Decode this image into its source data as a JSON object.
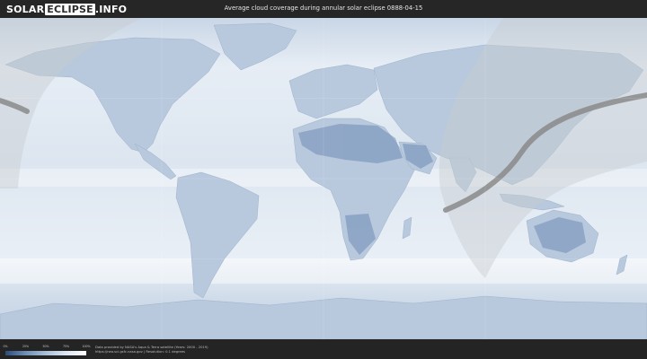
{
  "header": {
    "logo_part1": "SOLAR",
    "logo_part2": "ECLIPSE",
    "logo_part3": ".INFO",
    "title": "Average cloud coverage during annular solar eclipse 0888-04-15"
  },
  "legend": {
    "ticks": [
      "0%",
      "25%",
      "50%",
      "75%",
      "100%"
    ]
  },
  "footer": {
    "credit_line1": "Data provided by NASA's Aqua & Terra satellite (Years: 2000 - 2019)",
    "credit_line2": "https://neo.sci.gsfc.nasa.gov | Resolution: 0.1 degrees"
  },
  "colors": {
    "ocean": "#dfe7f1",
    "land": "#b9c9de",
    "dense_cloud": "#5f7ea8",
    "eclipse_path": "#8a8a8a",
    "visibility_region": "#cfd3d7"
  }
}
